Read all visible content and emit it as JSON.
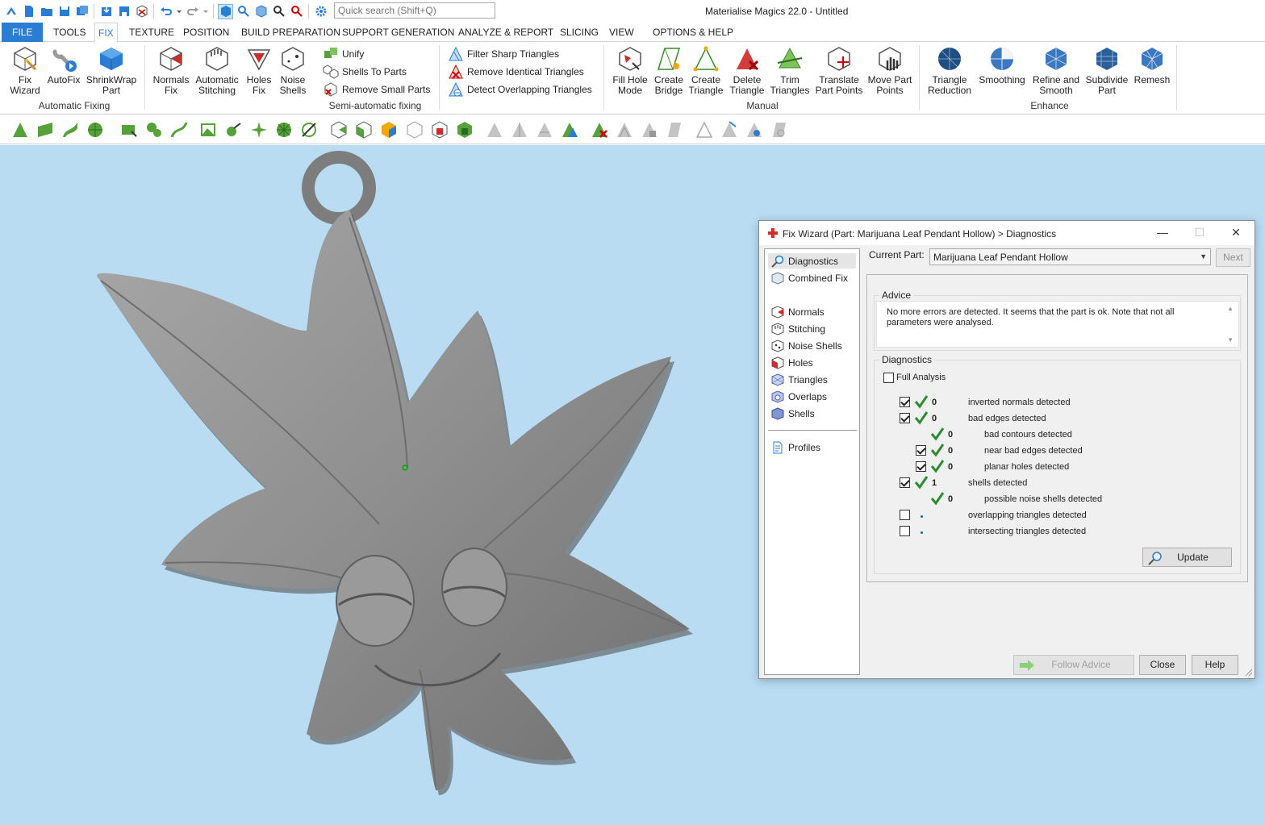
{
  "app": {
    "title": "Materialise Magics 22.0 - Untitled",
    "quick_search_placeholder": "Quick search (Shift+Q)"
  },
  "tabs": [
    "FILE",
    "TOOLS",
    "FIX",
    "TEXTURE",
    "POSITION",
    "BUILD PREPARATION",
    "SUPPORT GENERATION",
    "ANALYZE & REPORT",
    "SLICING",
    "VIEW",
    "OPTIONS & HELP"
  ],
  "active_tab": "FIX",
  "ribbon": {
    "automatic_fixing": {
      "label": "Automatic Fixing",
      "buttons": [
        {
          "l1": "Fix",
          "l2": "Wizard"
        },
        {
          "l1": "AutoFix",
          "l2": ""
        },
        {
          "l1": "ShrinkWrap",
          "l2": "Part"
        }
      ]
    },
    "semi_automatic": {
      "label": "Semi-automatic fixing",
      "buttons": [
        {
          "l1": "Normals",
          "l2": "Fix"
        },
        {
          "l1": "Automatic",
          "l2": "Stitching"
        },
        {
          "l1": "Holes",
          "l2": "Fix"
        },
        {
          "l1": "Noise",
          "l2": "Shells"
        }
      ],
      "small": [
        "Unify",
        "Shells To Parts",
        "Remove Small Parts"
      ],
      "triangles": [
        "Filter Sharp Triangles",
        "Remove Identical Triangles",
        "Detect Overlapping Triangles"
      ]
    },
    "manual": {
      "label": "Manual",
      "buttons": [
        {
          "l1": "Fill Hole",
          "l2": "Mode"
        },
        {
          "l1": "Create",
          "l2": "Bridge"
        },
        {
          "l1": "Create",
          "l2": "Triangle"
        },
        {
          "l1": "Delete",
          "l2": "Triangle"
        },
        {
          "l1": "Trim",
          "l2": "Triangles"
        },
        {
          "l1": "Translate",
          "l2": "Part Points"
        },
        {
          "l1": "Move Part",
          "l2": "Points"
        }
      ]
    },
    "enhance": {
      "label": "Enhance",
      "buttons": [
        {
          "l1": "Triangle",
          "l2": "Reduction"
        },
        {
          "l1": "Smoothing",
          "l2": ""
        },
        {
          "l1": "Refine and",
          "l2": "Smooth"
        },
        {
          "l1": "Subdivide",
          "l2": "Part"
        },
        {
          "l1": "Remesh",
          "l2": ""
        }
      ]
    }
  },
  "dialog": {
    "title": "Fix Wizard (Part: Marijuana Leaf Pendant Hollow) > Diagnostics",
    "nav": [
      "Diagnostics",
      "Combined Fix",
      "Normals",
      "Stitching",
      "Noise Shells",
      "Holes",
      "Triangles",
      "Overlaps",
      "Shells",
      "Profiles"
    ],
    "current_part_label": "Current Part:",
    "current_part_value": "Marijuana Leaf Pendant Hollow",
    "next_label": "Next",
    "advice_label": "Advice",
    "advice_text": "No more errors are detected. It seems that the part is ok. Note that not all parameters were analysed.",
    "diagnostics_label": "Diagnostics",
    "full_analysis_label": "Full Analysis",
    "rows": [
      {
        "count": "0",
        "text": "inverted normals detected",
        "checked": true,
        "indent": 0
      },
      {
        "count": "0",
        "text": "bad edges detected",
        "checked": true,
        "indent": 0
      },
      {
        "count": "0",
        "text": "bad contours detected",
        "checked": null,
        "indent": 1
      },
      {
        "count": "0",
        "text": "near bad edges detected",
        "checked": true,
        "indent": 1
      },
      {
        "count": "0",
        "text": "planar holes detected",
        "checked": true,
        "indent": 1
      },
      {
        "count": "1",
        "text": "shells detected",
        "checked": true,
        "indent": 0
      },
      {
        "count": "0",
        "text": "possible noise shells detected",
        "checked": null,
        "indent": 1
      },
      {
        "count": "",
        "text": "overlapping triangles detected",
        "checked": false,
        "indent": 0
      },
      {
        "count": "",
        "text": "intersecting triangles detected",
        "checked": false,
        "indent": 0
      }
    ],
    "update_label": "Update",
    "follow_advice_label": "Follow Advice",
    "close_label": "Close",
    "help_label": "Help"
  },
  "colors": {
    "accent": "#2b7cd3",
    "viewport_bg": "#b9dcf3",
    "tick_green": "#2e8b2e",
    "model_gray": "#8e8e8e"
  }
}
